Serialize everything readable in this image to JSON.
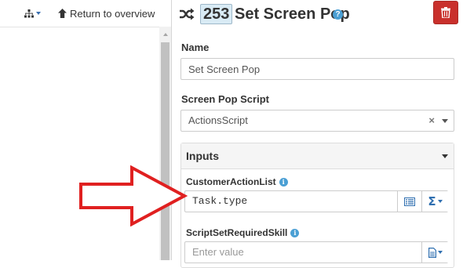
{
  "left": {
    "toolbar": {
      "tree_icon": "sitemap-icon",
      "return_icon": "arrow-up-icon",
      "return_label": "Return to overview"
    }
  },
  "header": {
    "type_icon": "shuffle-icon",
    "node_id": "253",
    "title": "Set Screen Pop",
    "help_icon": "question-circle-icon",
    "delete_icon": "trash-icon",
    "delete_color": "#c9302c"
  },
  "form": {
    "name_label": "Name",
    "name_value": "Set Screen Pop",
    "script_label": "Screen Pop Script",
    "script_value": "ActionsScript",
    "script_clear": "×",
    "inputs_title": "Inputs",
    "customer_action_list": {
      "label": "CustomerActionList",
      "info_icon": "info-circle-icon",
      "value": "Task.type",
      "list_icon": "list-icon",
      "sigma_label": "Σ"
    },
    "script_set_required_skill": {
      "label": "ScriptSetRequiredSkill",
      "info_icon": "info-circle-icon",
      "placeholder": "Enter value",
      "doc_icon": "document-icon"
    }
  },
  "overlay": {
    "annotation_icon": "red-arrow-icon",
    "annotation_color": "#e02020"
  },
  "colors": {
    "accent": "#2f6fb0",
    "id_badge_bg": "#d9ebf5",
    "info_blue": "#4a9fd4"
  }
}
